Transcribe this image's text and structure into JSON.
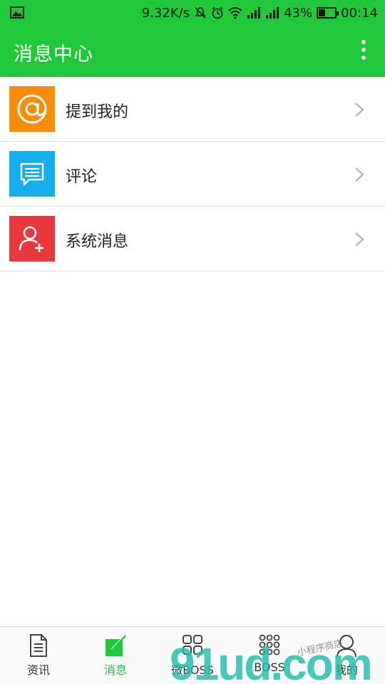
{
  "status": {
    "speed": "9.32K/s",
    "battery": "43%",
    "battery_level": 0.43,
    "time": "00:14"
  },
  "header": {
    "title": "消息中心",
    "menu_icon": "more-vertical-icon"
  },
  "list": {
    "items": [
      {
        "label": "提到我的",
        "icon": "at-icon",
        "color": "#ff8c00"
      },
      {
        "label": "评论",
        "icon": "comment-icon",
        "color": "#12aef0"
      },
      {
        "label": "系统消息",
        "icon": "user-add-icon",
        "color": "#e9373c"
      }
    ]
  },
  "bottom_nav": {
    "active_color": "#1fc93a",
    "tabs": [
      {
        "label": "资讯",
        "icon": "document-icon",
        "active": false
      },
      {
        "label": "消息",
        "icon": "edit-icon",
        "active": true
      },
      {
        "label": "微BOSS",
        "icon": "grid-icon",
        "active": false
      },
      {
        "label": "BOSS",
        "icon": "dots-grid-icon",
        "active": false
      },
      {
        "label": "我的",
        "icon": "person-icon",
        "active": false
      }
    ]
  },
  "watermark": {
    "text": "91ud.com",
    "subtext": "小程序商店"
  }
}
